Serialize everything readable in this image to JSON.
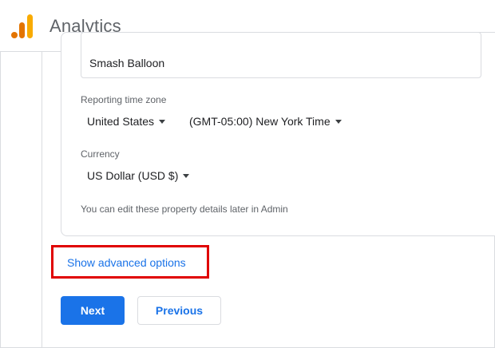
{
  "header": {
    "app_title": "Analytics",
    "logo_icon": "google-analytics-logo-icon"
  },
  "property": {
    "name_value": "Smash Balloon",
    "timezone_label": "Reporting time zone",
    "timezone_country": "United States",
    "timezone_value": "(GMT-05:00) New York Time",
    "currency_label": "Currency",
    "currency_value": "US Dollar (USD $)",
    "hint": "You can edit these property details later in Admin"
  },
  "advanced": {
    "link_label": "Show advanced options",
    "highlight_color": "#e00000"
  },
  "actions": {
    "next_label": "Next",
    "previous_label": "Previous",
    "accent": "#1a73e8"
  }
}
